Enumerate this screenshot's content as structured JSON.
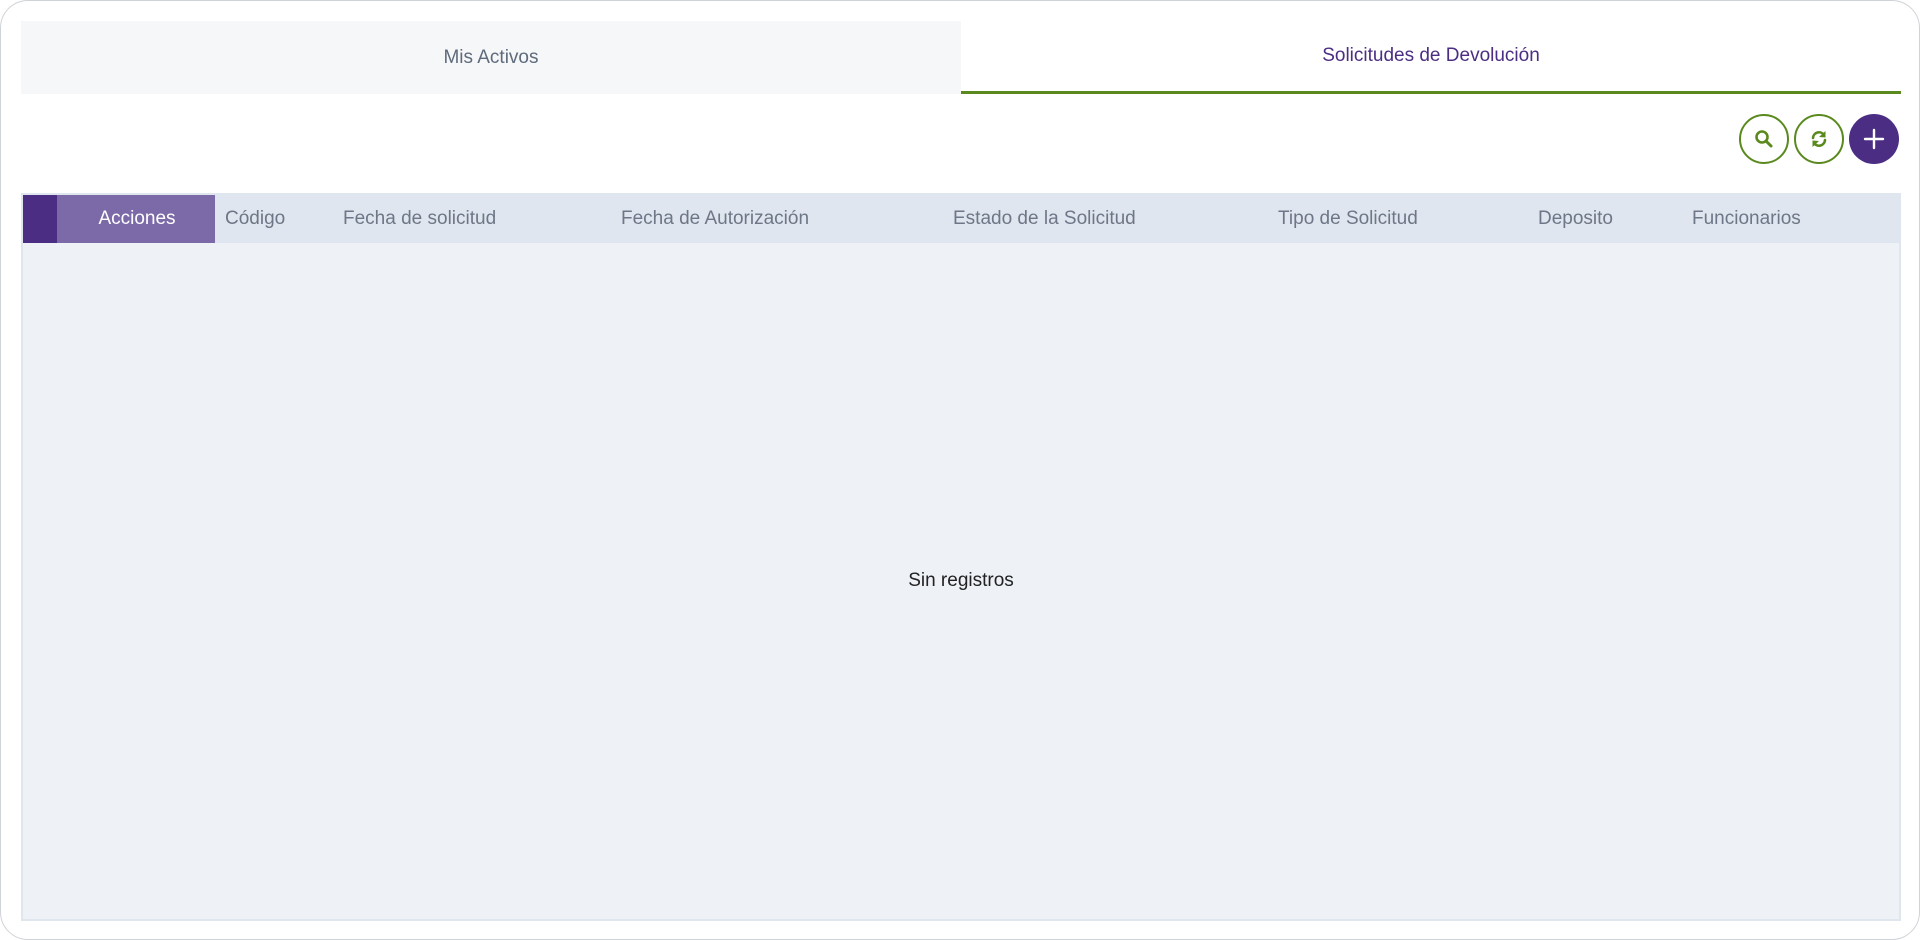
{
  "tabs": [
    {
      "label": "Mis Activos",
      "active": false
    },
    {
      "label": "Solicitudes de Devolución",
      "active": true
    }
  ],
  "toolbar": {
    "search_icon": "search-icon",
    "refresh_icon": "refresh-icon",
    "add_icon": "plus-icon"
  },
  "table": {
    "columns": [
      "Acciones",
      "Código",
      "Fecha de solicitud",
      "Fecha de Autorización",
      "Estado de la Solicitud",
      "Tipo de Solicitud",
      "Deposito",
      "Funcionarios"
    ],
    "empty_message": "Sin registros"
  },
  "colors": {
    "primary": "#4b2e83",
    "accent": "#5a8a1e",
    "header_bg": "#dfe6ef",
    "body_bg": "#eef2f7"
  }
}
